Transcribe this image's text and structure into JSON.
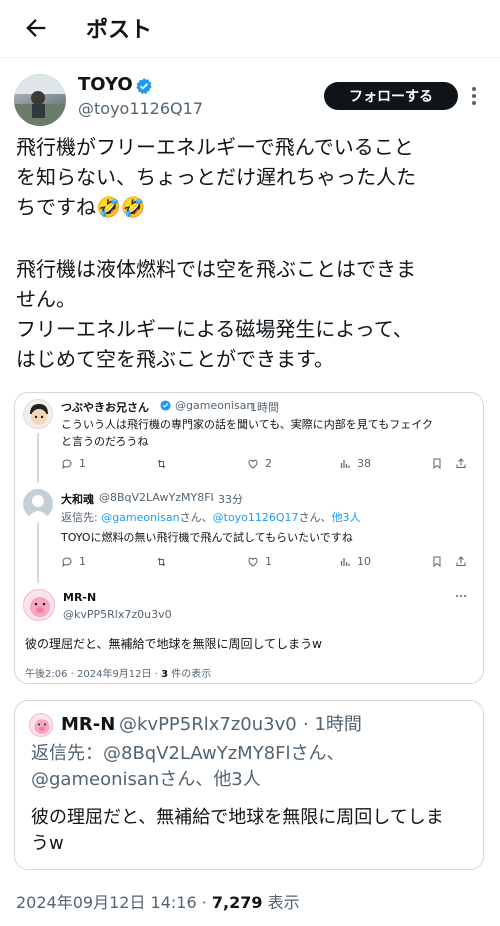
{
  "header": {
    "title": "ポスト"
  },
  "author": {
    "name": "TOYO",
    "handle": "@toyo1126Q17",
    "follow_label": "フォローする"
  },
  "post": {
    "line1": "飛行機がフリーエネルギーで飛んでいること",
    "line2": "を知らない、ちょっとだけ遅れちゃった人た",
    "line3": "ちですね🤣🤣",
    "line4": "飛行機は液体燃料では空を飛ぶことはできま",
    "line5": "せん。",
    "line6": "フリーエネルギーによる磁場発生によって、",
    "line7": "はじめて空を飛ぶことができます。"
  },
  "quoted_thread": {
    "tweet1": {
      "name": "つぶやきお兄さん",
      "handle": "@gameonisan",
      "time": "· 1時間",
      "text1": "こういう人は飛行機の専門家の話を聞いても、実際に内部を見てもフェイク",
      "text2": "と言うのだろうね",
      "replies": "1",
      "likes": "2",
      "views": "38"
    },
    "tweet2": {
      "name": "大和魂",
      "handle": "@8BqV2LAwYzMY8Fl",
      "time": "· 33分",
      "reply_prefix": "返信先: ",
      "reply_to1": "@gameonisan",
      "reply_mid": "さん、",
      "reply_to2": "@toyo1126Q17",
      "reply_mid2": "さん、",
      "reply_others": "他3人",
      "text": "TOYOに燃料の無い飛行機で飛んで試してもらいたいですね",
      "replies": "1",
      "likes": "1",
      "views": "10"
    },
    "tweet3": {
      "name": "MR-N",
      "handle": "@kvPP5Rlx7z0u3v0",
      "text": "彼の理屈だと、無補給で地球を無限に周回してしまうw",
      "timestamp": "午後2:06 · 2024年9月12日 · ",
      "views_count": "3",
      "views_label": " 件の表示"
    }
  },
  "quote2": {
    "name": "MR-N",
    "handle": "@kvPP5Rlx7z0u3v0",
    "time": "· 1時間",
    "reply_prefix": "返信先：",
    "reply_to1": "@8BqV2LAwYzMY8Flさん、",
    "reply_to2": "@gameonisanさん、",
    "reply_others": "他3人",
    "text1": "彼の理屈だと、無補給で地球を無限に周回してしま",
    "text2": "うw"
  },
  "footer": {
    "date": "2024年09月12日 14:16 · ",
    "views": "7,279",
    "views_label": " 表示"
  },
  "colors": {
    "accent": "#1d9bf0",
    "text": "#0f1419",
    "muted": "#536471",
    "border": "#cfd9de"
  }
}
